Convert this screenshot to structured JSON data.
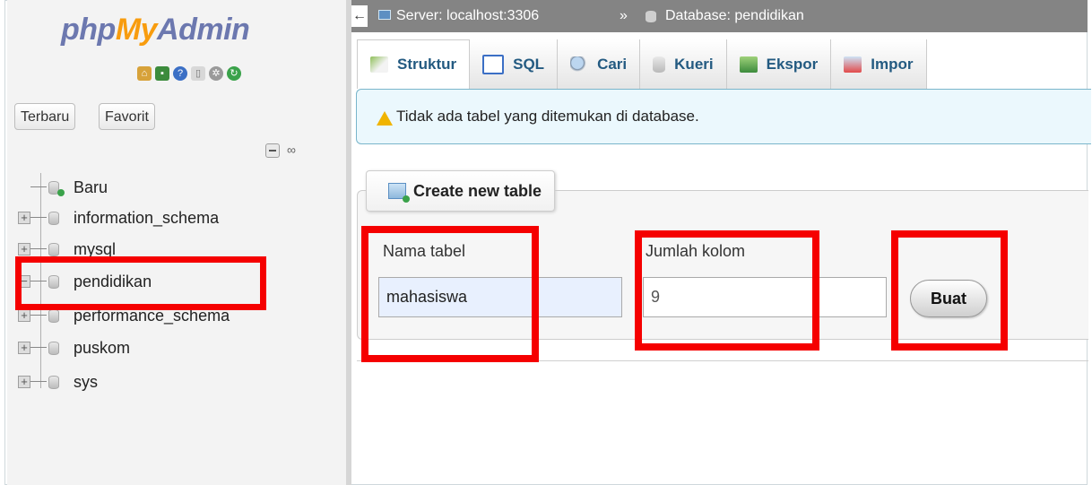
{
  "app": {
    "logo_part1": "php",
    "logo_part2": "My",
    "logo_part3": "Admin"
  },
  "nav": {
    "icons": [
      "home-icon",
      "exit-icon",
      "help-icon",
      "docs-icon",
      "settings-icon",
      "reload-icon"
    ],
    "tab_recent": "Terbaru",
    "tab_favorites": "Favorit",
    "tree": [
      {
        "label": "Baru",
        "icon": "new-db-icon",
        "expandable": false
      },
      {
        "label": "information_schema",
        "icon": "database-icon",
        "expandable": true
      },
      {
        "label": "mysql",
        "icon": "database-icon",
        "expandable": true
      },
      {
        "label": "pendidikan",
        "icon": "database-icon",
        "expandable": true,
        "expanded": true
      },
      {
        "label": "performance_schema",
        "icon": "database-icon",
        "expandable": true
      },
      {
        "label": "puskom",
        "icon": "database-icon",
        "expandable": true
      },
      {
        "label": "sys",
        "icon": "database-icon",
        "expandable": true
      }
    ]
  },
  "breadcrumb": {
    "server": "Server: localhost:3306",
    "separator": "»",
    "database": "Database: pendidikan"
  },
  "tabs": [
    "Struktur",
    "SQL",
    "Cari",
    "Kueri",
    "Ekspor",
    "Impor"
  ],
  "alert": {
    "message": "Tidak ada tabel yang ditemukan di database."
  },
  "create_table": {
    "legend": "Create new table",
    "name_label": "Nama tabel",
    "name_value": "mahasiswa",
    "cols_label": "Jumlah kolom",
    "cols_value": "9",
    "submit_label": "Buat"
  },
  "colors": {
    "highlight": "#f50000",
    "link": "#235a81",
    "topbar": "#848484",
    "alert_bg": "#ebf8fd"
  }
}
